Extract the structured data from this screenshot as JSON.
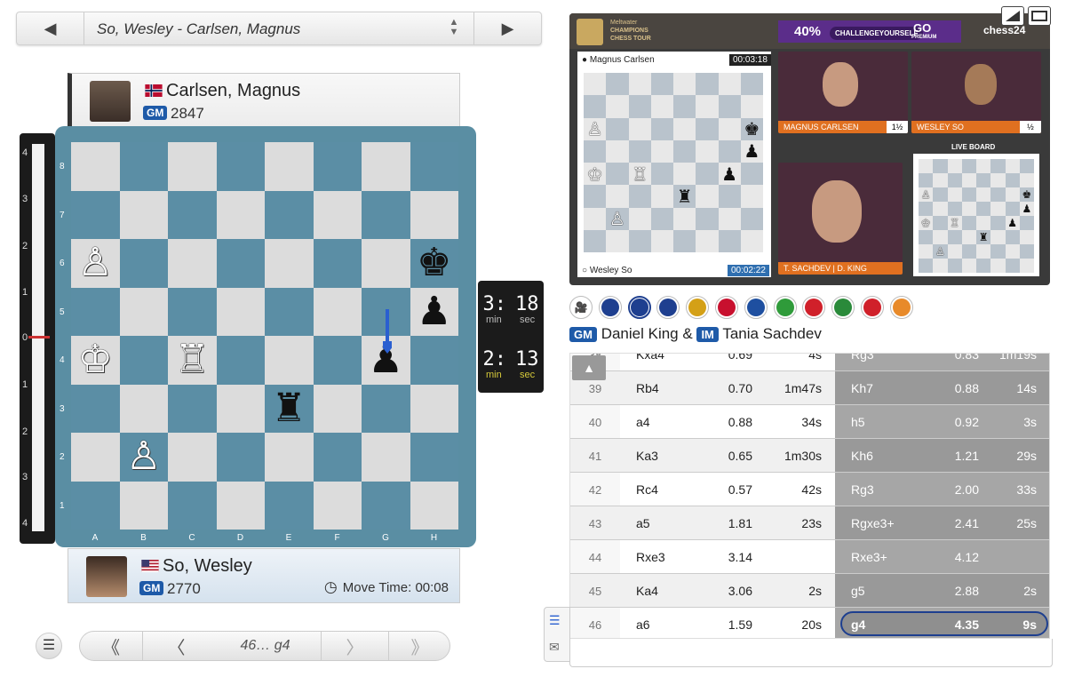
{
  "game_selector": {
    "title": "So, Wesley - Carlsen, Magnus",
    "prev_icon": "triangle-left-icon",
    "next_icon": "triangle-right-icon"
  },
  "top_player": {
    "name": "Carlsen, Magnus",
    "title": "GM",
    "rating": "2847",
    "flag": "NO"
  },
  "bottom_player": {
    "name": "So, Wesley",
    "title": "GM",
    "rating": "2770",
    "flag": "US",
    "move_time": "Move Time: 00:08"
  },
  "eval_bar": {
    "ticks_top": [
      "4",
      "3",
      "2",
      "1",
      "0"
    ],
    "ticks_bottom": [
      "1",
      "2",
      "3",
      "4"
    ]
  },
  "board": {
    "files": [
      "A",
      "B",
      "C",
      "D",
      "E",
      "F",
      "G",
      "H"
    ],
    "ranks": [
      "8",
      "7",
      "6",
      "5",
      "4",
      "3",
      "2",
      "1"
    ],
    "pieces": {
      "a6": "wP",
      "h6": "bK",
      "h5": "bP",
      "a4": "wK",
      "c4": "wR",
      "g4": "bP",
      "e3": "bR",
      "b2": "wP"
    },
    "last_move": "g5-g4"
  },
  "clock": {
    "top_min": "3",
    "top_sec": "18",
    "bottom_min": "2",
    "bottom_sec": "13",
    "min_label": "min",
    "sec_label": "sec"
  },
  "controls": {
    "current_move": "46… g4",
    "first_icon": "double-chevron-left-icon",
    "prev_icon": "chevron-left-icon",
    "next_icon": "chevron-right-icon",
    "last_icon": "double-chevron-right-icon"
  },
  "video": {
    "brand": "chess24",
    "promo": "40%",
    "promo_code": "CHALLENGEYOURSELF",
    "promo_go": "GO",
    "promo_premium": "PREMIUM",
    "tour_line1": "Meltwater",
    "tour_line2": "CHAMPIONS",
    "tour_line3": "CHESS TOUR",
    "mini_top_player": "Magnus Carlsen",
    "mini_top_time": "00:03:18",
    "mini_bottom_player": "Wesley So",
    "mini_bottom_time": "00:02:22",
    "cam1_label": "MAGNUS CARLSEN",
    "cam1_score": "1½",
    "cam2_label": "WESLEY SO",
    "cam2_score": "½",
    "cam3_label": "T. SACHDEV | D. KING",
    "live_board": "LIVE BOARD"
  },
  "languages": [
    "camera-icon",
    "gb",
    "gb",
    "gb",
    "de",
    "es",
    "fr",
    "br",
    "tr",
    "it",
    "pl",
    "in"
  ],
  "language_colors": {
    "gb": "#1e3f8f",
    "de": "#d4a017",
    "es": "#c8102e",
    "fr": "#1e4fa0",
    "br": "#2f9b3a",
    "tr": "#d0202a",
    "it": "#2a8a3a",
    "pl": "#d0202a",
    "in": "#e88a2a"
  },
  "commentators": {
    "gm_title": "GM",
    "gm_name": "Daniel King &",
    "im_title": "IM",
    "im_name": "Tania Sachdev"
  },
  "moves": [
    {
      "n": "38",
      "w": "Kxa4",
      "we": "0.69",
      "wt": "4s",
      "b": "Rg3",
      "be": "0.83",
      "bt": "1m19s"
    },
    {
      "n": "39",
      "w": "Rb4",
      "we": "0.70",
      "wt": "1m47s",
      "b": "Kh7",
      "be": "0.88",
      "bt": "14s"
    },
    {
      "n": "40",
      "w": "a4",
      "we": "0.88",
      "wt": "34s",
      "b": "h5",
      "be": "0.92",
      "bt": "3s"
    },
    {
      "n": "41",
      "w": "Ka3",
      "we": "0.65",
      "wt": "1m30s",
      "b": "Kh6",
      "be": "1.21",
      "bt": "29s"
    },
    {
      "n": "42",
      "w": "Rc4",
      "we": "0.57",
      "wt": "42s",
      "b": "Rg3",
      "be": "2.00",
      "bt": "33s"
    },
    {
      "n": "43",
      "w": "a5",
      "we": "1.81",
      "wt": "23s",
      "b": "Rgxe3+",
      "be": "2.41",
      "bt": "25s"
    },
    {
      "n": "44",
      "w": "Rxe3",
      "we": "3.14",
      "wt": "",
      "b": "Rxe3+",
      "be": "4.12",
      "bt": ""
    },
    {
      "n": "45",
      "w": "Ka4",
      "we": "3.06",
      "wt": "2s",
      "b": "g5",
      "be": "2.88",
      "bt": "2s"
    },
    {
      "n": "46",
      "w": "a6",
      "we": "1.59",
      "wt": "20s",
      "b": "g4",
      "be": "4.35",
      "bt": "9s"
    }
  ]
}
